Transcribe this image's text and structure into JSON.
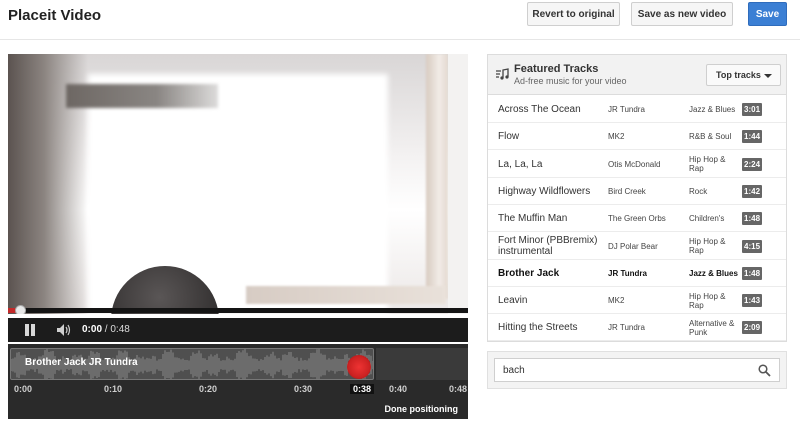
{
  "header": {
    "title": "Placeit Video",
    "revert_label": "Revert to original",
    "save_as_new_label": "Save as new video",
    "save_label": "Save"
  },
  "player": {
    "current_time": "0:00",
    "duration": "/ 0:48",
    "state": "playing",
    "progress": 0.02
  },
  "waveform": {
    "track_label": "Brother Jack JR Tundra",
    "ticks": [
      "0:00",
      "0:10",
      "0:20",
      "0:30",
      "0:38",
      "0:40",
      "0:48"
    ],
    "highlighted_tick": "0:38",
    "done_label": "Done positioning"
  },
  "panel": {
    "title": "Featured Tracks",
    "subtitle": "Ad-free music for your video",
    "sort_label": "Top tracks",
    "tracks": [
      {
        "name": "Across The Ocean",
        "artist": "JR Tundra",
        "genre": "Jazz & Blues",
        "duration": "3:01",
        "selected": false
      },
      {
        "name": "Flow",
        "artist": "MK2",
        "genre": "R&B & Soul",
        "duration": "1:44",
        "selected": false
      },
      {
        "name": "La, La, La",
        "artist": "Otis McDonald",
        "genre": "Hip Hop & Rap",
        "duration": "2:24",
        "selected": false
      },
      {
        "name": "Highway Wildflowers",
        "artist": "Bird Creek",
        "genre": "Rock",
        "duration": "1:42",
        "selected": false
      },
      {
        "name": "The Muffin Man",
        "artist": "The Green Orbs",
        "genre": "Children's",
        "duration": "1:48",
        "selected": false
      },
      {
        "name": "Fort Minor (PBBremix) instrumental",
        "artist": "DJ Polar Bear",
        "genre": "Hip Hop & Rap",
        "duration": "4:15",
        "selected": false
      },
      {
        "name": "Brother Jack",
        "artist": "JR Tundra",
        "genre": "Jazz & Blues",
        "duration": "1:48",
        "selected": true
      },
      {
        "name": "Leavin",
        "artist": "MK2",
        "genre": "Hip Hop & Rap",
        "duration": "1:43",
        "selected": false
      },
      {
        "name": "Hitting the Streets",
        "artist": "JR Tundra",
        "genre": "Alternative & Punk",
        "duration": "2:09",
        "selected": false
      }
    ]
  },
  "search": {
    "value": "bach",
    "icon": "search-icon"
  },
  "colors": {
    "save_button": "#3b7fd4",
    "progress_red": "#c52a2a",
    "duration_badge": "#666666"
  }
}
